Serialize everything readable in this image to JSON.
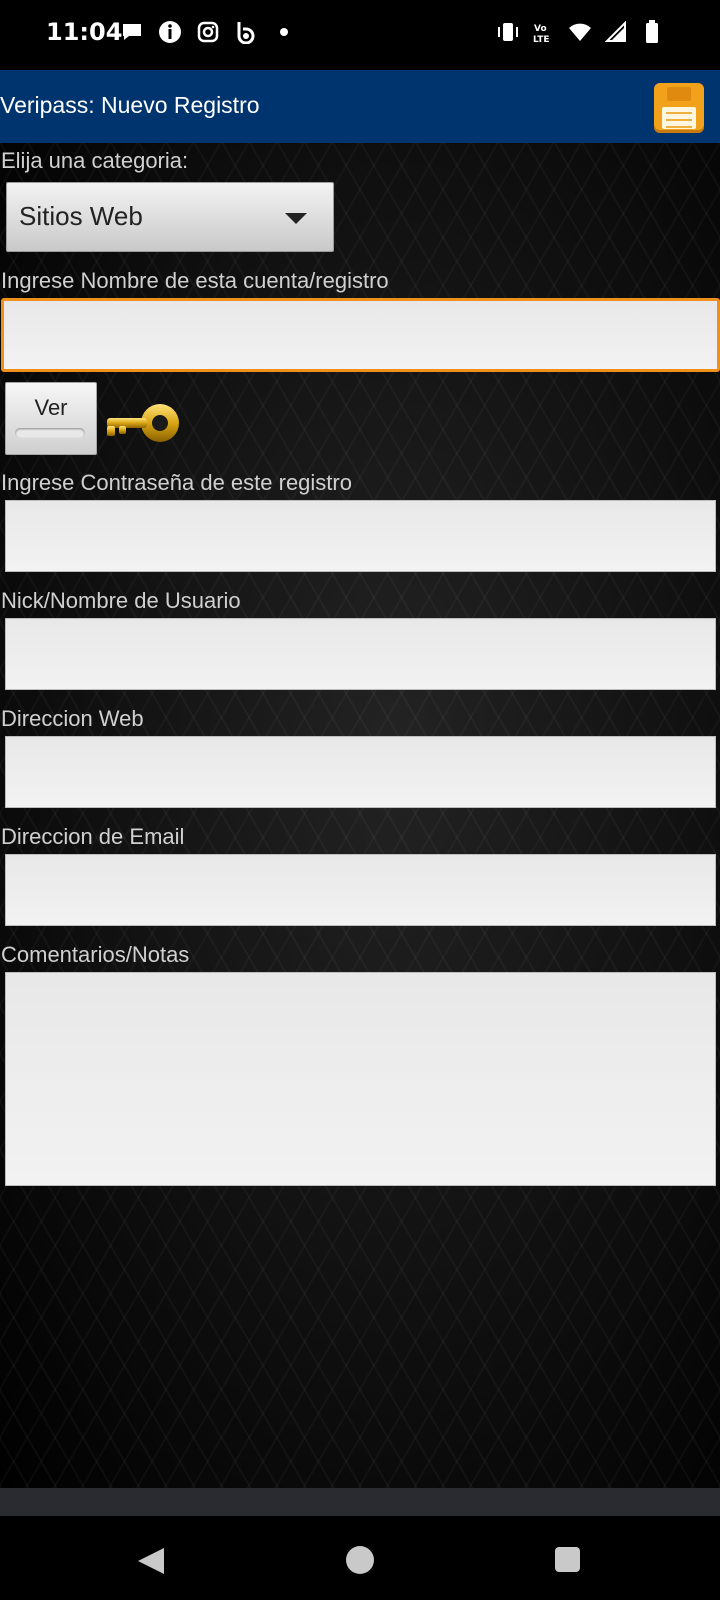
{
  "status_bar": {
    "time": "11:04",
    "left_icons": [
      "chat-bubble-icon",
      "info-icon",
      "instagram-icon",
      "beats-icon",
      "dot-icon"
    ],
    "right_icons": [
      "vibrate-icon",
      "volte-icon",
      "wifi-icon",
      "signal-icon",
      "battery-icon"
    ]
  },
  "title_bar": {
    "title": "Veripass: Nuevo Registro"
  },
  "form": {
    "category_label": "Elija una categoria:",
    "category_value": "Sitios Web",
    "account_name_label": "Ingrese Nombre de esta cuenta/registro",
    "account_name_value": "",
    "show_button_label": "Ver",
    "password_label": "Ingrese Contraseña de este registro",
    "password_value": "",
    "username_label": "Nick/Nombre de Usuario",
    "username_value": "",
    "web_label": "Direccion Web",
    "web_value": "",
    "email_label": "Direccion de Email",
    "email_value": "",
    "notes_label": "Comentarios/Notas",
    "notes_value": ""
  },
  "colors": {
    "title_bar": "#00346f",
    "focus_border": "#f0901c",
    "save_icon": "#f2a21a"
  }
}
